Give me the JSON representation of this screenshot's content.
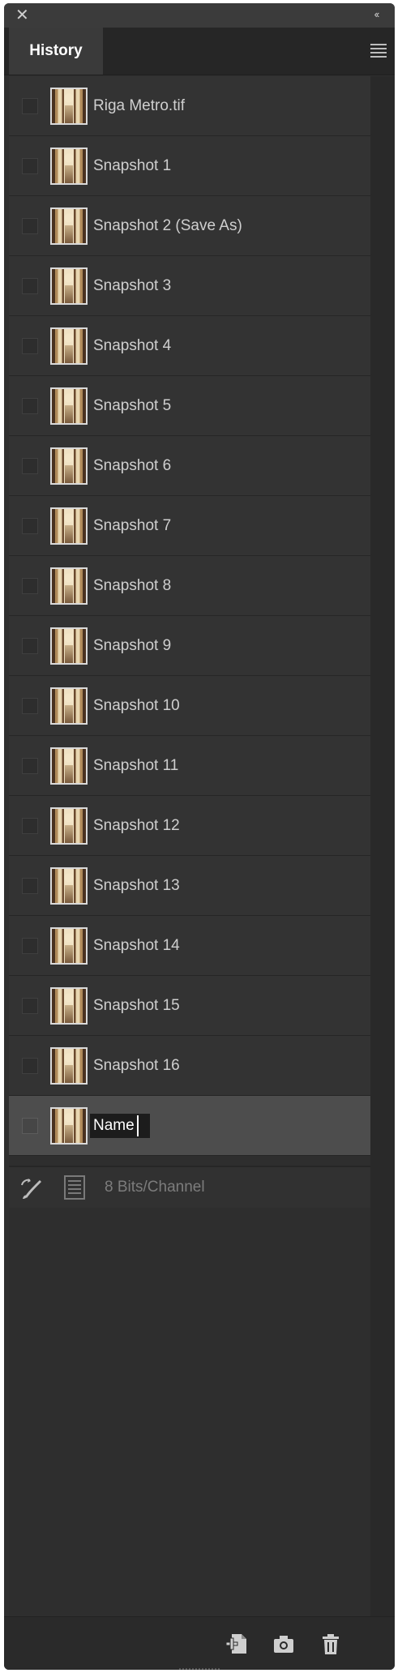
{
  "panel": {
    "tab_label": "History",
    "close_glyph": "✕",
    "collapse_glyph": "‹‹"
  },
  "history": {
    "items": [
      {
        "label": "Riga Metro.tif"
      },
      {
        "label": "Snapshot 1"
      },
      {
        "label": "Snapshot 2 (Save As)"
      },
      {
        "label": "Snapshot 3"
      },
      {
        "label": "Snapshot 4"
      },
      {
        "label": "Snapshot 5"
      },
      {
        "label": "Snapshot 6"
      },
      {
        "label": "Snapshot 7"
      },
      {
        "label": "Snapshot 8"
      },
      {
        "label": "Snapshot 9"
      },
      {
        "label": "Snapshot 10"
      },
      {
        "label": "Snapshot 11"
      },
      {
        "label": "Snapshot 12"
      },
      {
        "label": "Snapshot 13"
      },
      {
        "label": "Snapshot 14"
      },
      {
        "label": "Snapshot 15"
      },
      {
        "label": "Snapshot 16"
      }
    ],
    "editing_value": "Name"
  },
  "status": {
    "text": "8 Bits/Channel"
  },
  "icons": {
    "close": "close-icon",
    "collapse": "double-chevron-left-icon",
    "menu": "hamburger-menu-icon",
    "history_brush": "history-brush-icon",
    "document": "document-icon",
    "new_document": "new-document-icon",
    "snapshot": "camera-icon",
    "delete": "trash-icon"
  },
  "colors": {
    "panel_bg": "#2f2f2f",
    "row_bg": "#333333",
    "selected_row_bg": "#4d4d4d",
    "text": "#cfcfcf",
    "muted_text": "#7c7c7c"
  }
}
